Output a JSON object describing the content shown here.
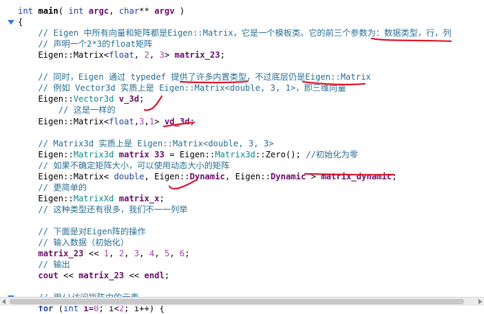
{
  "code_lines": [
    {
      "y": 0,
      "segments": [
        {
          "t": "int",
          "c": "id"
        },
        {
          "t": " ",
          "c": "op"
        },
        {
          "t": "main",
          "c": "fn"
        },
        {
          "t": "( ",
          "c": "op"
        },
        {
          "t": "int",
          "c": "id"
        },
        {
          "t": " ",
          "c": "op"
        },
        {
          "t": "argc",
          "c": "var"
        },
        {
          "t": ", ",
          "c": "op"
        },
        {
          "t": "char",
          "c": "id"
        },
        {
          "t": "** ",
          "c": "op"
        },
        {
          "t": "argv",
          "c": "var"
        },
        {
          "t": " )",
          "c": "op"
        }
      ]
    },
    {
      "y": 1,
      "segments": [
        {
          "t": "{",
          "c": "op"
        }
      ]
    },
    {
      "y": 2,
      "segments": [
        {
          "t": "    // Eigen 中所有向量和矩阵都是Eigen::Matrix，它是一个模板类。它的前三个参数为：数据类型，行，列",
          "c": "cm"
        }
      ]
    },
    {
      "y": 3,
      "segments": [
        {
          "t": "    // 声明一个2*3的float矩阵",
          "c": "cm"
        }
      ]
    },
    {
      "y": 4,
      "segments": [
        {
          "t": "    Eigen::",
          "c": "op"
        },
        {
          "t": "Matrix",
          "c": "op"
        },
        {
          "t": "<",
          "c": "op"
        },
        {
          "t": "float",
          "c": "id"
        },
        {
          "t": ", ",
          "c": "op"
        },
        {
          "t": "2",
          "c": "num"
        },
        {
          "t": ", ",
          "c": "op"
        },
        {
          "t": "3",
          "c": "num"
        },
        {
          "t": "> ",
          "c": "op"
        },
        {
          "t": "matrix_23",
          "c": "var"
        },
        {
          "t": ";",
          "c": "op"
        }
      ]
    },
    {
      "y": 5,
      "segments": []
    },
    {
      "y": 6,
      "segments": [
        {
          "t": "    // 同时，Eigen 通过 typedef 提供了许多内置类型，不过底层仍是Eigen::Matrix",
          "c": "cm"
        }
      ]
    },
    {
      "y": 7,
      "segments": [
        {
          "t": "    // 例如 Vector3d 实质上是 Eigen::Matrix<double, 3, 1>，即三维向量",
          "c": "cm"
        }
      ]
    },
    {
      "y": 8,
      "segments": [
        {
          "t": "    Eigen::",
          "c": "op"
        },
        {
          "t": "Vector3d",
          "c": "ns"
        },
        {
          "t": " ",
          "c": "op"
        },
        {
          "t": "v_3d",
          "c": "var"
        },
        {
          "t": ";",
          "c": "op"
        }
      ]
    },
    {
      "y": 9,
      "segments": [
        {
          "t": "        // 这是一样的",
          "c": "cm"
        }
      ]
    },
    {
      "y": 10,
      "segments": [
        {
          "t": "    Eigen::",
          "c": "op"
        },
        {
          "t": "Matrix",
          "c": "op"
        },
        {
          "t": "<",
          "c": "op"
        },
        {
          "t": "float",
          "c": "id"
        },
        {
          "t": ",",
          "c": "op"
        },
        {
          "t": "3",
          "c": "num"
        },
        {
          "t": ",",
          "c": "op"
        },
        {
          "t": "1",
          "c": "num"
        },
        {
          "t": "> ",
          "c": "op"
        },
        {
          "t": "vd_3d",
          "c": "var"
        },
        {
          "t": ";",
          "c": "op"
        }
      ]
    },
    {
      "y": 11,
      "segments": []
    },
    {
      "y": 12,
      "segments": [
        {
          "t": "    // Matrix3d 实质上是 Eigen::Matrix<double, 3, 3>",
          "c": "cm"
        }
      ]
    },
    {
      "y": 13,
      "segments": [
        {
          "t": "    Eigen::",
          "c": "op"
        },
        {
          "t": "Matrix3d",
          "c": "ns"
        },
        {
          "t": " ",
          "c": "op"
        },
        {
          "t": "matrix 33",
          "c": "var"
        },
        {
          "t": " = Eigen::",
          "c": "op"
        },
        {
          "t": "Matrix3d",
          "c": "ns"
        },
        {
          "t": "::",
          "c": "op"
        },
        {
          "t": "Zero",
          "c": "op"
        },
        {
          "t": "(); ",
          "c": "op"
        },
        {
          "t": "//初始化为零",
          "c": "cm"
        }
      ]
    },
    {
      "y": 14,
      "segments": [
        {
          "t": "    // 如果不确定矩阵大小，可以使用动态大小的矩阵",
          "c": "cm"
        }
      ]
    },
    {
      "y": 15,
      "segments": [
        {
          "t": "    Eigen::",
          "c": "op"
        },
        {
          "t": "Matrix",
          "c": "op"
        },
        {
          "t": "< ",
          "c": "op"
        },
        {
          "t": "double",
          "c": "id"
        },
        {
          "t": ", Eigen::",
          "c": "op"
        },
        {
          "t": "Dynamic",
          "c": "var"
        },
        {
          "t": ", Eigen::",
          "c": "op"
        },
        {
          "t": "Dynamic",
          "c": "var"
        },
        {
          "t": " > ",
          "c": "op"
        },
        {
          "t": "matrix_dynamic",
          "c": "var"
        },
        {
          "t": ";",
          "c": "op"
        }
      ]
    },
    {
      "y": 16,
      "segments": [
        {
          "t": "    // 更简单的",
          "c": "cm"
        }
      ]
    },
    {
      "y": 17,
      "segments": [
        {
          "t": "    Eigen::",
          "c": "op"
        },
        {
          "t": "MatrixXd",
          "c": "ns"
        },
        {
          "t": " ",
          "c": "op"
        },
        {
          "t": "matrix_x",
          "c": "var"
        },
        {
          "t": ";",
          "c": "op"
        }
      ]
    },
    {
      "y": 18,
      "segments": [
        {
          "t": "    // 这种类型还有很多，我们不一一列举",
          "c": "cm"
        }
      ]
    },
    {
      "y": 19,
      "segments": []
    },
    {
      "y": 20,
      "segments": [
        {
          "t": "    // 下面是对Eigen阵的操作",
          "c": "cm"
        }
      ]
    },
    {
      "y": 21,
      "segments": [
        {
          "t": "    // 输入数据（初始化）",
          "c": "cm"
        }
      ]
    },
    {
      "y": 22,
      "segments": [
        {
          "t": "    ",
          "c": "op"
        },
        {
          "t": "matrix_23",
          "c": "var"
        },
        {
          "t": " << ",
          "c": "op"
        },
        {
          "t": "1",
          "c": "num"
        },
        {
          "t": ", ",
          "c": "op"
        },
        {
          "t": "2",
          "c": "num"
        },
        {
          "t": ", ",
          "c": "op"
        },
        {
          "t": "3",
          "c": "num"
        },
        {
          "t": ", ",
          "c": "op"
        },
        {
          "t": "4",
          "c": "num"
        },
        {
          "t": ", ",
          "c": "op"
        },
        {
          "t": "5",
          "c": "num"
        },
        {
          "t": ", ",
          "c": "op"
        },
        {
          "t": "6",
          "c": "num"
        },
        {
          "t": ";",
          "c": "op"
        }
      ]
    },
    {
      "y": 23,
      "segments": [
        {
          "t": "    // 输出",
          "c": "cm"
        }
      ]
    },
    {
      "y": 24,
      "segments": [
        {
          "t": "    ",
          "c": "op"
        },
        {
          "t": "cout",
          "c": "var"
        },
        {
          "t": " << ",
          "c": "op"
        },
        {
          "t": "matrix_23",
          "c": "var"
        },
        {
          "t": " << ",
          "c": "op"
        },
        {
          "t": "endl",
          "c": "var"
        },
        {
          "t": ";",
          "c": "op"
        }
      ]
    },
    {
      "y": 25,
      "segments": []
    },
    {
      "y": 26,
      "segments": [
        {
          "t": "    // 用()访问矩阵中的元素",
          "c": "cm"
        }
      ]
    },
    {
      "y": 27,
      "segments": [
        {
          "t": "    ",
          "c": "op"
        },
        {
          "t": "for",
          "c": "kw"
        },
        {
          "t": " (",
          "c": "op"
        },
        {
          "t": "int",
          "c": "id"
        },
        {
          "t": " ",
          "c": "op"
        },
        {
          "t": "i",
          "c": "var"
        },
        {
          "t": "=",
          "c": "op"
        },
        {
          "t": "0",
          "c": "num"
        },
        {
          "t": "; i<",
          "c": "op"
        },
        {
          "t": "2",
          "c": "num"
        },
        {
          "t": "; i++) {",
          "c": "op"
        }
      ]
    }
  ],
  "fold_markers": [
    1,
    26
  ],
  "colors": {
    "annotation": "#e0142a",
    "fold": "#3a7bd5"
  }
}
